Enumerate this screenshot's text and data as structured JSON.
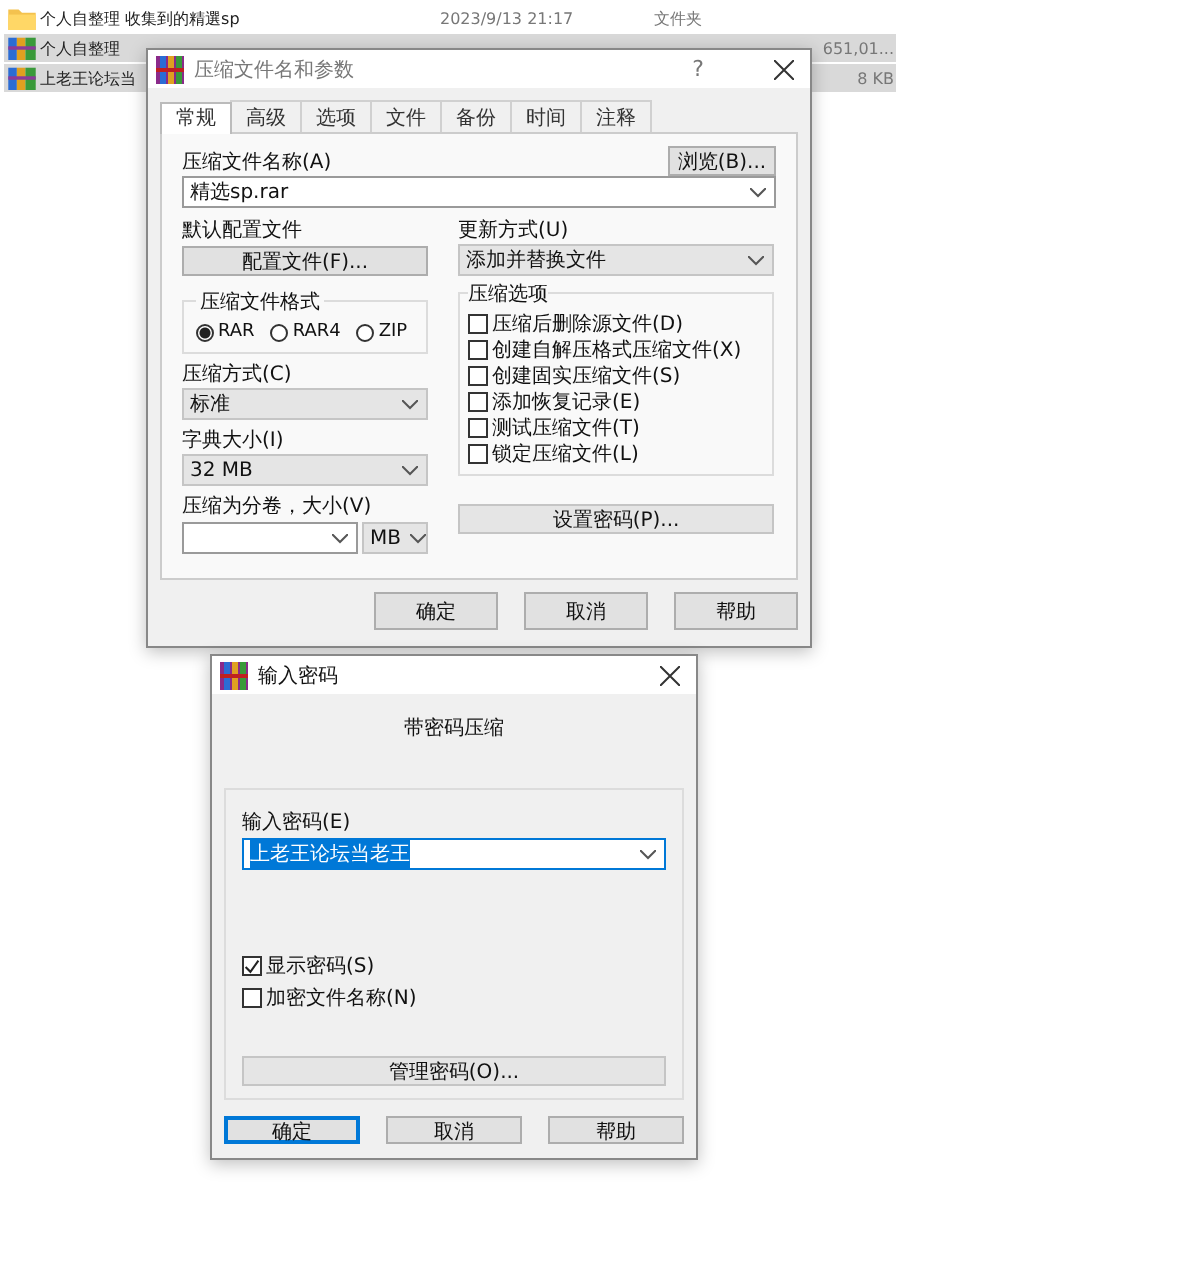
{
  "file_list": {
    "rows": [
      {
        "kind": "folder",
        "name": "个人自整理 收集到的精選sp",
        "date": "2023/9/13 21:17",
        "type": "文件夹",
        "selected": false
      },
      {
        "kind": "archive",
        "name": "个人自整理",
        "size": "651,01...",
        "selected": true
      },
      {
        "kind": "archive",
        "name": "上老王论坛当",
        "size": "8 KB",
        "selected": true
      }
    ]
  },
  "archive_dialog": {
    "title": "压缩文件名和参数",
    "help": "?",
    "tabs": [
      {
        "label": "常规",
        "selected": true
      },
      {
        "label": "高级",
        "selected": false
      },
      {
        "label": "选项",
        "selected": false
      },
      {
        "label": "文件",
        "selected": false
      },
      {
        "label": "备份",
        "selected": false
      },
      {
        "label": "时间",
        "selected": false
      },
      {
        "label": "注释",
        "selected": false
      }
    ],
    "archive_name_label": "压缩文件名称(A)",
    "browse_button": "浏览(B)...",
    "archive_name_value": "精选sp.rar",
    "profile_label": "默认配置文件",
    "profile_button": "配置文件(F)...",
    "update_mode_label": "更新方式(U)",
    "update_mode_value": "添加并替换文件",
    "format_group": {
      "title": "压缩文件格式",
      "options": [
        {
          "label": "RAR",
          "selected": true
        },
        {
          "label": "RAR4",
          "selected": false
        },
        {
          "label": "ZIP",
          "selected": false
        }
      ]
    },
    "method_label": "压缩方式(C)",
    "method_value": "标准",
    "dictionary_label": "字典大小(I)",
    "dictionary_value": "32 MB",
    "volume_label": "压缩为分卷，大小(V)",
    "volume_unit": "MB",
    "options_group": {
      "title": "压缩选项",
      "items": [
        {
          "label": "压缩后删除源文件(D)",
          "checked": false
        },
        {
          "label": "创建自解压格式压缩文件(X)",
          "checked": false
        },
        {
          "label": "创建固实压缩文件(S)",
          "checked": false
        },
        {
          "label": "添加恢复记录(E)",
          "checked": false
        },
        {
          "label": "测试压缩文件(T)",
          "checked": false
        },
        {
          "label": "锁定压缩文件(L)",
          "checked": false
        }
      ]
    },
    "password_button": "设置密码(P)...",
    "buttons": [
      {
        "label": "确定",
        "focused": false
      },
      {
        "label": "取消",
        "focused": false
      },
      {
        "label": "帮助",
        "focused": false
      }
    ]
  },
  "password_dialog": {
    "title": "输入密码",
    "heading": "带密码压缩",
    "password_label": "输入密码(E)",
    "password_value": "上老王论坛当老王",
    "password_selected": true,
    "checkboxes": [
      {
        "label": "显示密码(S)",
        "checked": true
      },
      {
        "label": "加密文件名称(N)",
        "checked": false
      }
    ],
    "manage_button": "管理密码(O)...",
    "buttons": [
      {
        "label": "确定",
        "focused": true
      },
      {
        "label": "取消",
        "focused": false
      },
      {
        "label": "帮助",
        "focused": false
      }
    ]
  }
}
